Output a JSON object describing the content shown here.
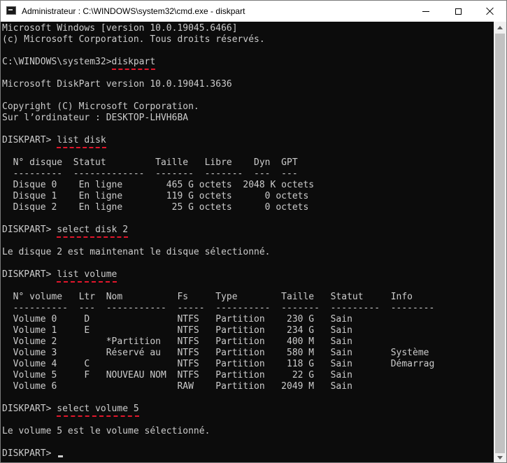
{
  "window": {
    "title": "Administrateur : C:\\WINDOWS\\system32\\cmd.exe - diskpart"
  },
  "console": {
    "lines": [
      {
        "text": "Microsoft Windows [version 10.0.19045.6466]"
      },
      {
        "text": "(c) Microsoft Corporation. Tous droits réservés."
      },
      {
        "text": ""
      },
      {
        "text": "C:\\WINDOWS\\system32>",
        "cmd": "diskpart"
      },
      {
        "text": ""
      },
      {
        "text": "Microsoft DiskPart version 10.0.19041.3636"
      },
      {
        "text": ""
      },
      {
        "text": "Copyright (C) Microsoft Corporation."
      },
      {
        "text": "Sur l’ordinateur : DESKTOP-LHVH6BA"
      },
      {
        "text": ""
      },
      {
        "text": "DISKPART> ",
        "cmd": "list disk"
      },
      {
        "text": ""
      },
      {
        "text": "  N° disque  Statut         Taille   Libre    Dyn  GPT"
      },
      {
        "text": "  ---------  -------------  -------  -------  ---  ---"
      },
      {
        "text": "  Disque 0    En ligne        465 G octets  2048 K octets"
      },
      {
        "text": "  Disque 1    En ligne        119 G octets      0 octets"
      },
      {
        "text": "  Disque 2    En ligne         25 G octets      0 octets"
      },
      {
        "text": ""
      },
      {
        "text": "DISKPART> ",
        "cmd": "select disk 2"
      },
      {
        "text": ""
      },
      {
        "text": "Le disque 2 est maintenant le disque sélectionné."
      },
      {
        "text": ""
      },
      {
        "text": "DISKPART> ",
        "cmd": "list volume"
      },
      {
        "text": ""
      },
      {
        "text": "  N° volume   Ltr  Nom          Fs     Type        Taille   Statut     Info"
      },
      {
        "text": "  ----------  ---  -----------  -----  ----------  -------  ---------  --------"
      },
      {
        "text": "  Volume 0     D                NTFS   Partition    230 G   Sain"
      },
      {
        "text": "  Volume 1     E                NTFS   Partition    234 G   Sain"
      },
      {
        "text": "  Volume 2         *Partition   NTFS   Partition    400 M   Sain"
      },
      {
        "text": "  Volume 3         Réservé au   NTFS   Partition    580 M   Sain       Système"
      },
      {
        "text": "  Volume 4     C                NTFS   Partition    118 G   Sain       Démarrag"
      },
      {
        "text": "  Volume 5     F   NOUVEAU NOM  NTFS   Partition     22 G   Sain"
      },
      {
        "text": "  Volume 6                      RAW    Partition   2049 M   Sain"
      },
      {
        "text": ""
      },
      {
        "text": "DISKPART> ",
        "cmd": "select volume 5"
      },
      {
        "text": ""
      },
      {
        "text": "Le volume 5 est le volume sélectionné."
      },
      {
        "text": ""
      },
      {
        "text": "DISKPART> ",
        "cursor": true
      }
    ]
  }
}
